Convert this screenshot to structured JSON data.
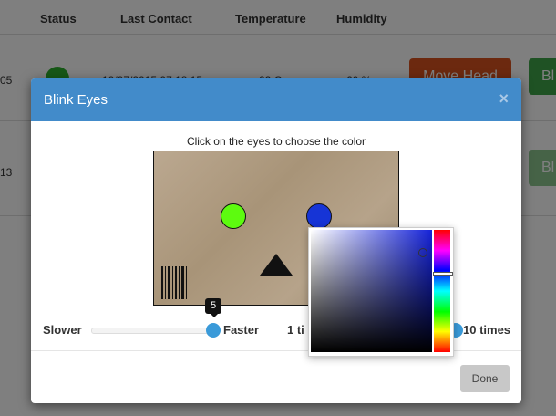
{
  "table": {
    "headers": [
      "Status",
      "Last Contact",
      "Temperature",
      "Humidity"
    ],
    "rows": [
      {
        "id_suffix": "05",
        "last_contact": "10/07/2015 07:18:15",
        "temperature": "22 C",
        "humidity": "60 %",
        "status_color": "#2fb12f"
      },
      {
        "id_suffix": "13"
      }
    ],
    "move_head_label": "Move Head",
    "blink_label": "Bl"
  },
  "modal": {
    "title": "Blink Eyes",
    "close_glyph": "×",
    "instruction": "Click on the eyes to choose the color",
    "left_eye_color": "#5dfb0f",
    "right_eye_color": "#1634d6",
    "speed": {
      "slower_label": "Slower",
      "faster_label": "Faster",
      "value": "5"
    },
    "times": {
      "min_label": "1 ti",
      "max_label": "10 times"
    },
    "done_label": "Done"
  },
  "color_picker": {
    "hue_color": "#1523d8"
  },
  "colors": {
    "header_bg": "#428bca",
    "move_head": "#d9531e",
    "blink": "#3fa548",
    "slider_handle": "#3a9ad9"
  }
}
